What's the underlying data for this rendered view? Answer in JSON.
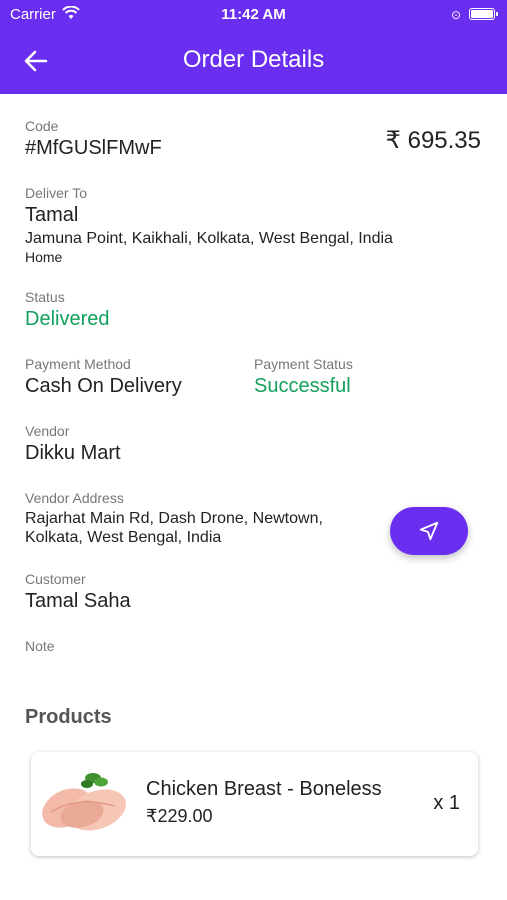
{
  "status_bar": {
    "carrier": "Carrier",
    "time": "11:42 AM"
  },
  "header": {
    "title": "Order Details",
    "back_icon": "arrow-left-icon"
  },
  "order": {
    "code_label": "Code",
    "code": "#MfGUSlFMwF",
    "amount": "₹ 695.35",
    "deliver_label": "Deliver To",
    "deliver_name": "Tamal",
    "deliver_address": "Jamuna Point, Kaikhali, Kolkata, West Bengal, India",
    "deliver_type": "Home",
    "status_label": "Status",
    "status": "Delivered",
    "payment_method_label": "Payment Method",
    "payment_method": "Cash On Delivery",
    "payment_status_label": "Payment Status",
    "payment_status": "Successful",
    "vendor_label": "Vendor",
    "vendor": "Dikku Mart",
    "vendor_address_label": "Vendor Address",
    "vendor_address_line1": "Rajarhat Main Rd, Dash Drone, Newtown,",
    "vendor_address_line2": "Kolkata, West Bengal, India",
    "customer_label": "Customer",
    "customer": "Tamal Saha",
    "note_label": "Note"
  },
  "products": {
    "title": "Products",
    "items": [
      {
        "name": "Chicken Breast - Boneless",
        "price": "₹229.00",
        "qty": "x 1"
      }
    ]
  },
  "colors": {
    "accent": "#6a2ef0",
    "success": "#12a05c"
  }
}
